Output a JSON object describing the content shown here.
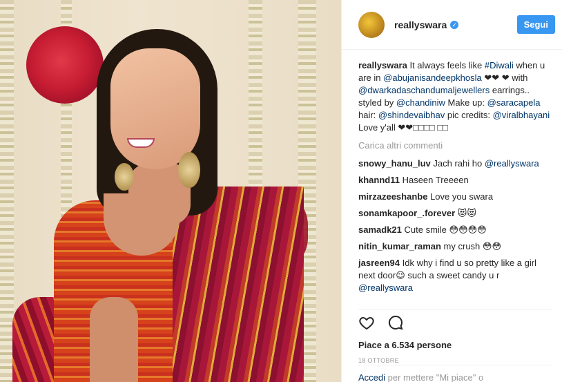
{
  "post": {
    "username": "reallyswara",
    "verified_icon": "verified-badge-icon",
    "follow_label": "Segui",
    "caption_segments": [
      {
        "t": "It always feels like ",
        "tag": false
      },
      {
        "t": "#Diwali",
        "tag": true
      },
      {
        "t": " when u are in ",
        "tag": false
      },
      {
        "t": "@abujanisandeepkhosla",
        "tag": true
      },
      {
        "t": " ❤❤ ❤ with ",
        "tag": false
      },
      {
        "t": "@dwarkadaschandumaljewellers",
        "tag": true
      },
      {
        "t": " earrings.. styled by ",
        "tag": false
      },
      {
        "t": "@chandiniw",
        "tag": true
      },
      {
        "t": " Make up: ",
        "tag": false
      },
      {
        "t": "@saracapela",
        "tag": true
      },
      {
        "t": " hair: ",
        "tag": false
      },
      {
        "t": "@shindevaibhav",
        "tag": true
      },
      {
        "t": " pic credits: ",
        "tag": false
      },
      {
        "t": "@viralbhayani",
        "tag": true
      },
      {
        "t": " Love y'all ❤❤□□□□ □□",
        "tag": false
      }
    ],
    "load_more": "Carica altri commenti",
    "comments": [
      {
        "user": "snowy_hanu_luv",
        "text": "Jach rahi ho ",
        "mention": "@reallyswara"
      },
      {
        "user": "khannd11",
        "text": "Haseen Treeeen",
        "mention": ""
      },
      {
        "user": "mirzazeeshanbe",
        "text": "Love you swara",
        "mention": ""
      },
      {
        "user": "sonamkapoor_.forever",
        "text": "😻😻",
        "mention": ""
      },
      {
        "user": "samadk21",
        "text": "Cute smile 😳😳😳😳",
        "mention": ""
      },
      {
        "user": "nitin_kumar_raman",
        "text": "my crush 😳😳",
        "mention": ""
      },
      {
        "user": "jasreen94",
        "text": "Idk why i find u so pretty like a girl next door😉 such a sweet candy u r ",
        "mention": "@reallyswara"
      }
    ],
    "likes": "Piace a 6.534 persone",
    "date": "18 OTTOBRE",
    "add_comment_prefix": "Accedi",
    "add_comment_rest": " per mettere \"Mi piace\" o"
  },
  "icons": {
    "like": "heart-icon",
    "comment": "comment-icon"
  }
}
